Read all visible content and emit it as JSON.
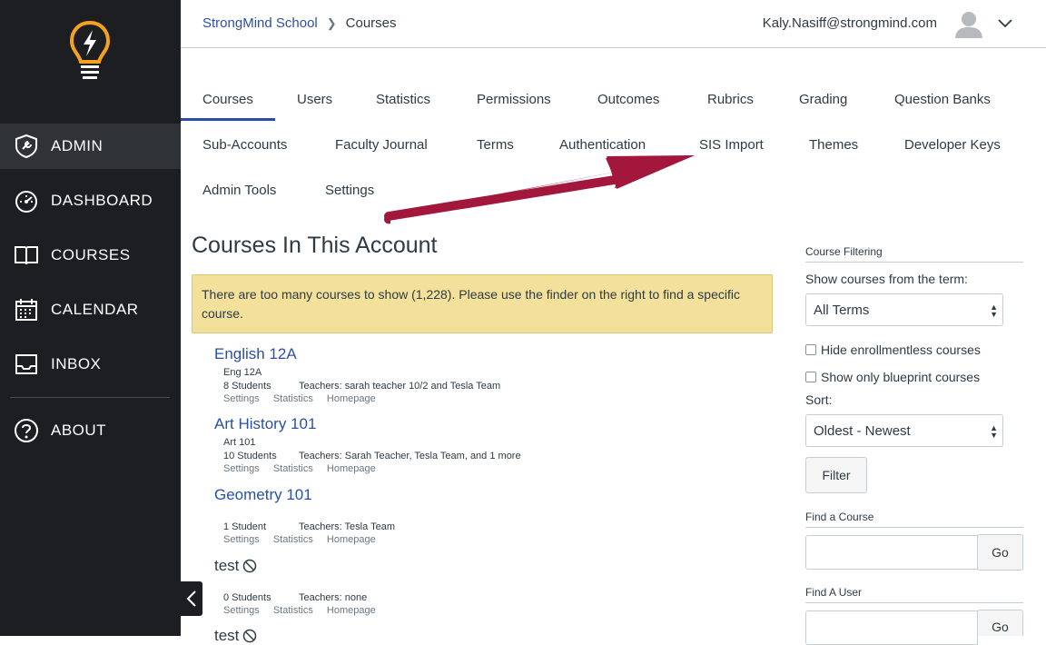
{
  "sidebar": {
    "items": [
      {
        "label": "ADMIN",
        "icon": "admin-shield-icon"
      },
      {
        "label": "DASHBOARD",
        "icon": "speedometer-icon"
      },
      {
        "label": "COURSES",
        "icon": "book-icon"
      },
      {
        "label": "CALENDAR",
        "icon": "calendar-icon"
      },
      {
        "label": "INBOX",
        "icon": "inbox-icon"
      },
      {
        "label": "ABOUT",
        "icon": "question-circle-icon"
      }
    ]
  },
  "header": {
    "breadcrumb": {
      "root": "StrongMind School",
      "current": "Courses"
    },
    "user_email": "Kaly.Nasiff@strongmind.com"
  },
  "tabs": {
    "row1": [
      "Courses",
      "Users",
      "Statistics",
      "Permissions",
      "Outcomes",
      "Rubrics",
      "Grading",
      "Question Banks"
    ],
    "row2": [
      "Sub-Accounts",
      "Faculty Journal",
      "Terms",
      "Authentication",
      "SIS Import",
      "Themes",
      "Developer Keys"
    ],
    "row3": [
      "Admin Tools",
      "Settings"
    ],
    "active": "Courses"
  },
  "main": {
    "title": "Courses In This Account",
    "alert": "There are too many courses to show (1,228). Please use the finder on the right to find a specific course.",
    "courses": [
      {
        "name": "English 12A",
        "code": "Eng 12A",
        "students": "8 Students",
        "teachers": "Teachers: sarah teacher 10/2 and Tesla Team"
      },
      {
        "name": "Art History 101",
        "code": "Art 101",
        "students": "10 Students",
        "teachers": "Teachers: Sarah Teacher, Tesla Team, and 1 more"
      },
      {
        "name": "Geometry 101",
        "code": "",
        "students": "1 Student",
        "teachers": "Teachers: Tesla Team"
      },
      {
        "name": "test",
        "code": "",
        "students": "0 Students",
        "teachers": "Teachers: none"
      },
      {
        "name": "test",
        "code": "",
        "students": "",
        "teachers": ""
      }
    ],
    "links": {
      "settings": "Settings",
      "statistics": "Statistics",
      "homepage": "Homepage"
    }
  },
  "filter": {
    "section_label": "Course Filtering",
    "term_label": "Show courses from the term:",
    "term_value": "All Terms",
    "hide_enrollmentless": "Hide enrollmentless courses",
    "show_blueprint": "Show only blueprint courses",
    "sort_label": "Sort:",
    "sort_value": "Oldest - Newest",
    "filter_button": "Filter",
    "find_course_label": "Find a Course",
    "find_user_label": "Find A User",
    "go_button": "Go"
  },
  "colors": {
    "sidebar_bg": "#1c1e22",
    "link": "#2b4fa6",
    "alert_bg": "#f3e09a",
    "annotation_arrow": "#a3173c"
  }
}
